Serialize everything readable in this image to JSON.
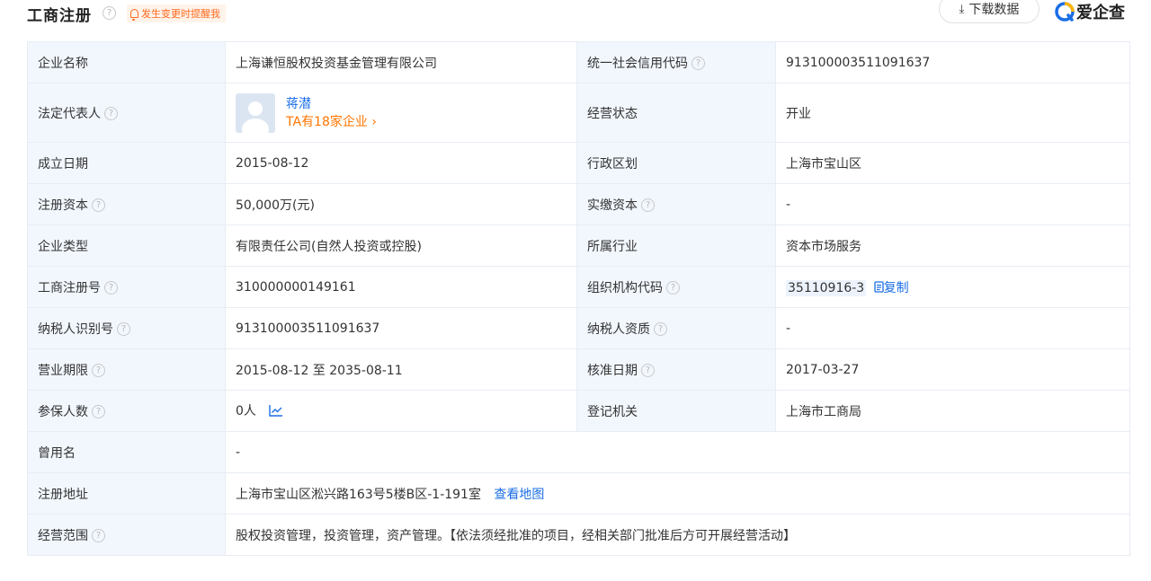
{
  "header": {
    "title": "工商注册",
    "remind_label": "发生变更时提醒我",
    "download_label": "下载数据",
    "brand_name": "爱企查",
    "help_glyph": "?"
  },
  "icons": {
    "help": "help-circle-icon",
    "remind": "bell-icon",
    "download": "download-icon",
    "brand": "aiqicha-logo-icon",
    "copy": "copy-icon",
    "trend": "trend-chart-icon",
    "arrow": "chevron-right-icon"
  },
  "colors": {
    "label_bg": "#f2f7fe",
    "border": "#e8edf4",
    "link": "#1a6ee6",
    "orange": "#ff7500"
  },
  "fields": {
    "company_name": {
      "label": "企业名称",
      "value": "上海谦恒股权投资基金管理有限公司"
    },
    "credit_code": {
      "label": "统一社会信用代码",
      "value": "913100003511091637"
    },
    "legal_rep": {
      "label": "法定代表人",
      "name": "蒋潜",
      "companies": "TA有18家企业",
      "arrow": "›"
    },
    "status": {
      "label": "经营状态",
      "value": "开业"
    },
    "founded": {
      "label": "成立日期",
      "value": "2015-08-12"
    },
    "region": {
      "label": "行政区划",
      "value": "上海市宝山区"
    },
    "reg_capital": {
      "label": "注册资本",
      "value": "50,000万(元)"
    },
    "paid_capital": {
      "label": "实缴资本",
      "value": "-"
    },
    "company_type": {
      "label": "企业类型",
      "value": "有限责任公司(自然人投资或控股)"
    },
    "industry": {
      "label": "所属行业",
      "value": "资本市场服务"
    },
    "reg_no": {
      "label": "工商注册号",
      "value": "310000000149161"
    },
    "org_code": {
      "label": "组织机构代码",
      "value": "35110916-3",
      "copy_label": "复制"
    },
    "taxpayer_id": {
      "label": "纳税人识别号",
      "value": "913100003511091637"
    },
    "taxpayer_qual": {
      "label": "纳税人资质",
      "value": "-"
    },
    "business_term": {
      "label": "营业期限",
      "value": "2015-08-12 至 2035-08-11"
    },
    "approval_date": {
      "label": "核准日期",
      "value": "2017-03-27"
    },
    "insured": {
      "label": "参保人数",
      "value": "0人"
    },
    "authority": {
      "label": "登记机关",
      "value": "上海市工商局"
    },
    "former_name": {
      "label": "曾用名",
      "value": "-"
    },
    "address": {
      "label": "注册地址",
      "value": "上海市宝山区淞兴路163号5楼B区-1-191室",
      "map_label": "查看地图"
    },
    "scope": {
      "label": "经营范围",
      "value": "股权投资管理，投资管理，资产管理。【依法须经批准的项目，经相关部门批准后方可开展经营活动】"
    }
  }
}
